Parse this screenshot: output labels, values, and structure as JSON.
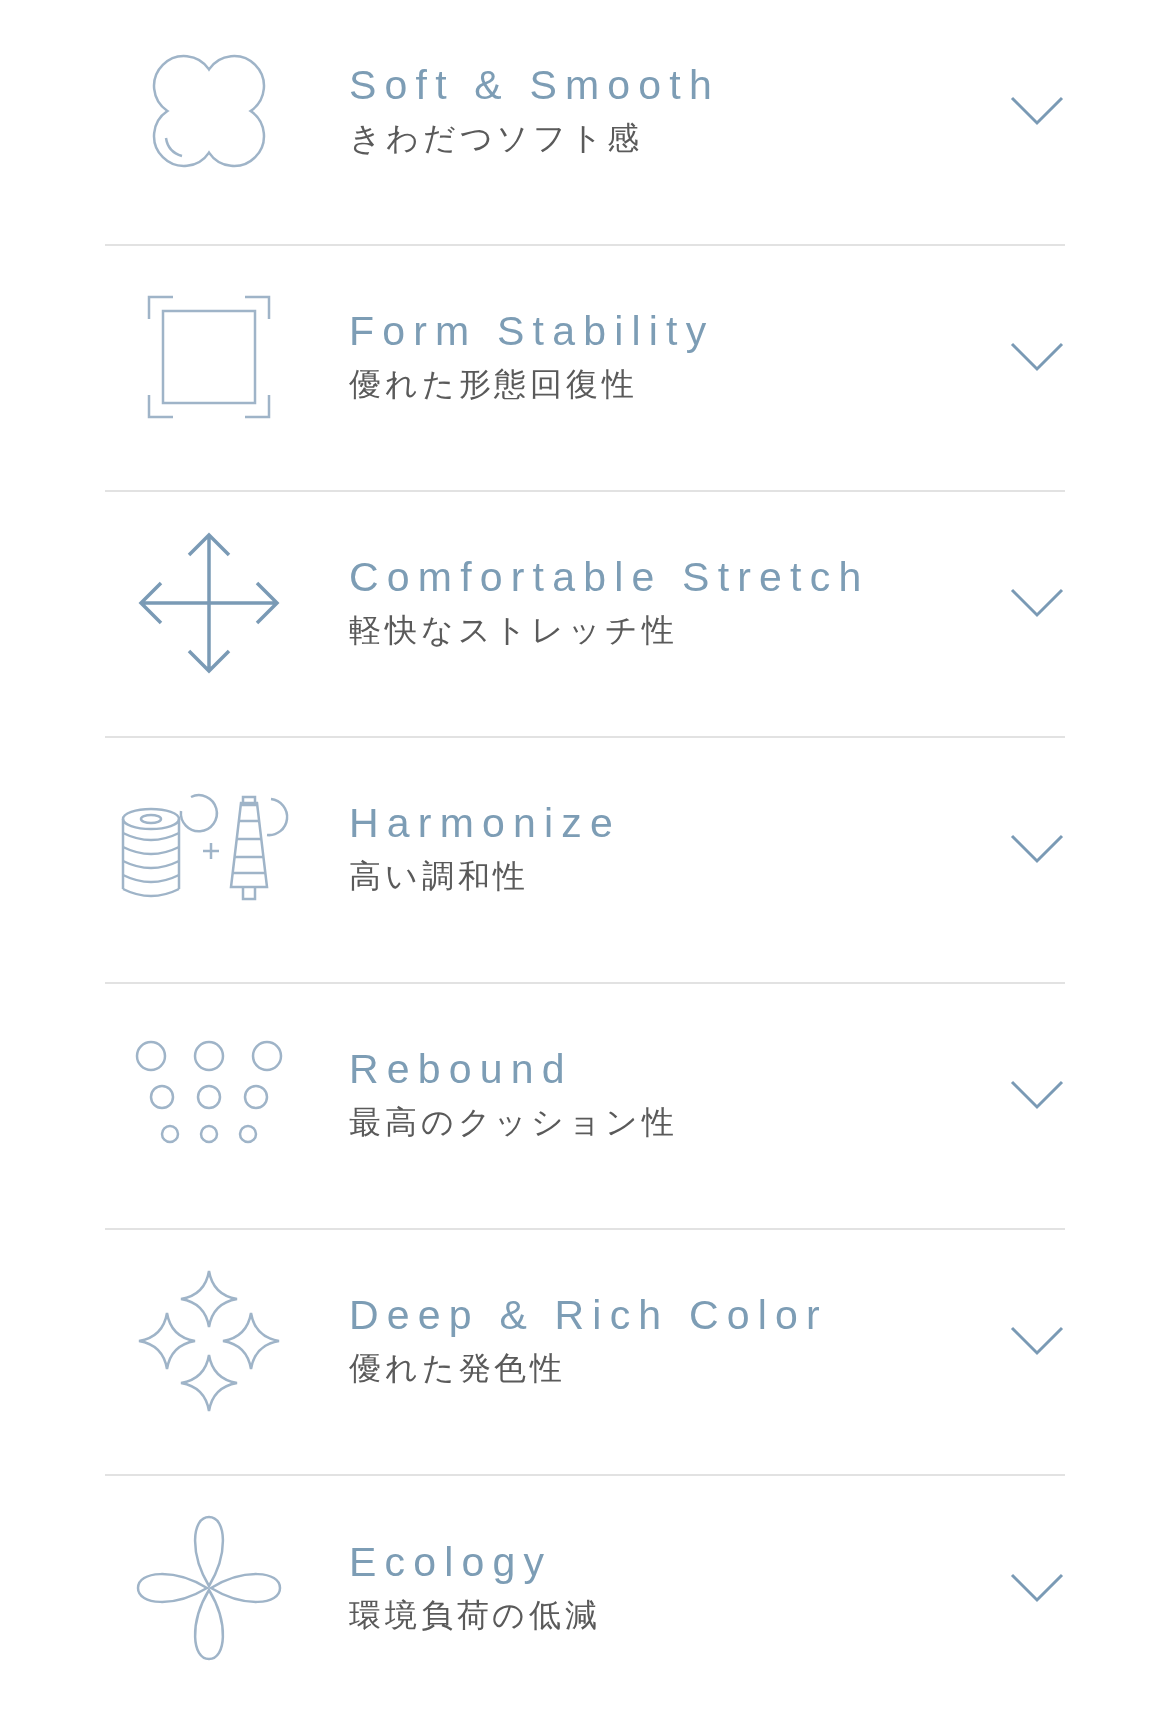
{
  "features": [
    {
      "kind": "cloud",
      "title": "Soft & Smooth",
      "subtitle": "きわだつソフト感",
      "expanded": false
    },
    {
      "kind": "frame",
      "title": "Form Stability",
      "subtitle": "優れた形態回復性",
      "expanded": false
    },
    {
      "kind": "arrows",
      "title": "Comfortable Stretch",
      "subtitle": "軽快なストレッチ性",
      "expanded": false
    },
    {
      "kind": "spools",
      "title": "Harmonize",
      "subtitle": "高い調和性",
      "expanded": false
    },
    {
      "kind": "dots",
      "title": "Rebound",
      "subtitle": "最高のクッション性",
      "expanded": false
    },
    {
      "kind": "sparkles",
      "title": "Deep & Rich Color",
      "subtitle": "優れた発色性",
      "expanded": false
    },
    {
      "kind": "petals",
      "title": "Ecology",
      "subtitle": "環境負荷の低減",
      "expanded": false
    }
  ]
}
